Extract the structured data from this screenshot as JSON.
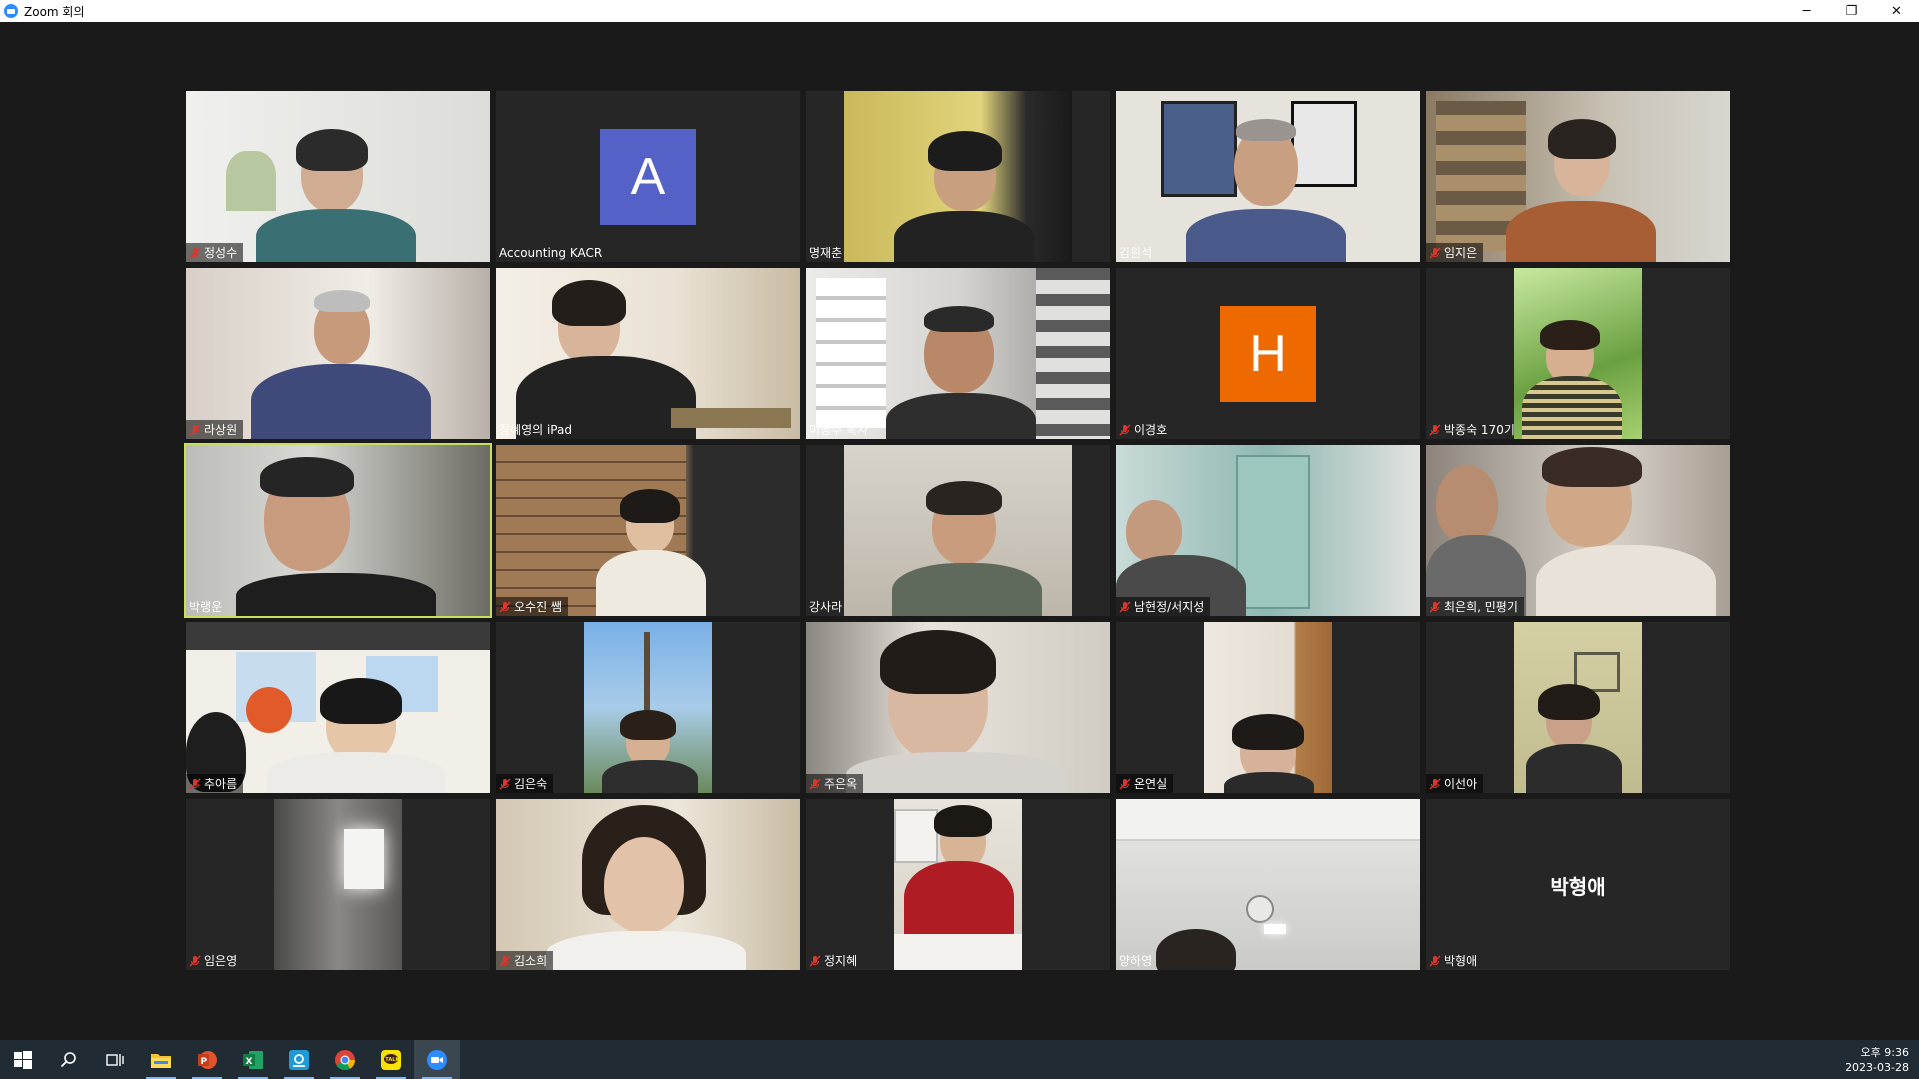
{
  "window": {
    "title": "Zoom 회의",
    "minimize": "─",
    "restore": "❐",
    "close": "✕"
  },
  "avatars": {
    "A": "A",
    "H": "H"
  },
  "participants": [
    {
      "name": "정성수"
    },
    {
      "name": "Accounting KACR"
    },
    {
      "name": "명재춘"
    },
    {
      "name": "김원석"
    },
    {
      "name": "임지은"
    },
    {
      "name": "라상원"
    },
    {
      "name": "장혜영의 iPad"
    },
    {
      "name": "이병주 목사"
    },
    {
      "name": "이경호"
    },
    {
      "name": "박종숙 170기"
    },
    {
      "name": "박랭운"
    },
    {
      "name": "오수진 쌤"
    },
    {
      "name": "강사라"
    },
    {
      "name": "남현정/서지성"
    },
    {
      "name": "최은희, 민평기"
    },
    {
      "name": "추아름"
    },
    {
      "name": "김은숙"
    },
    {
      "name": "주은옥"
    },
    {
      "name": "온연실"
    },
    {
      "name": "이선아"
    },
    {
      "name": "임은영"
    },
    {
      "name": "김소희"
    },
    {
      "name": "정지혜"
    },
    {
      "name": "양하영"
    },
    {
      "name": "박형애"
    }
  ],
  "no_video_label": "박형애",
  "colors": {
    "avatar_a": "#5461c7",
    "avatar_h": "#ee6a00",
    "active_speaker": "#c6e05c",
    "mute": "#e0352b"
  },
  "taskbar": {
    "icons": [
      "windows-start-icon",
      "search-icon",
      "task-view-icon",
      "file-explorer-icon",
      "powerpoint-icon",
      "excel-icon",
      "hangul-icon",
      "chrome-icon",
      "kakaotalk-icon",
      "zoom-icon"
    ],
    "time": "오후 9:36",
    "date": "2023-03-28"
  }
}
